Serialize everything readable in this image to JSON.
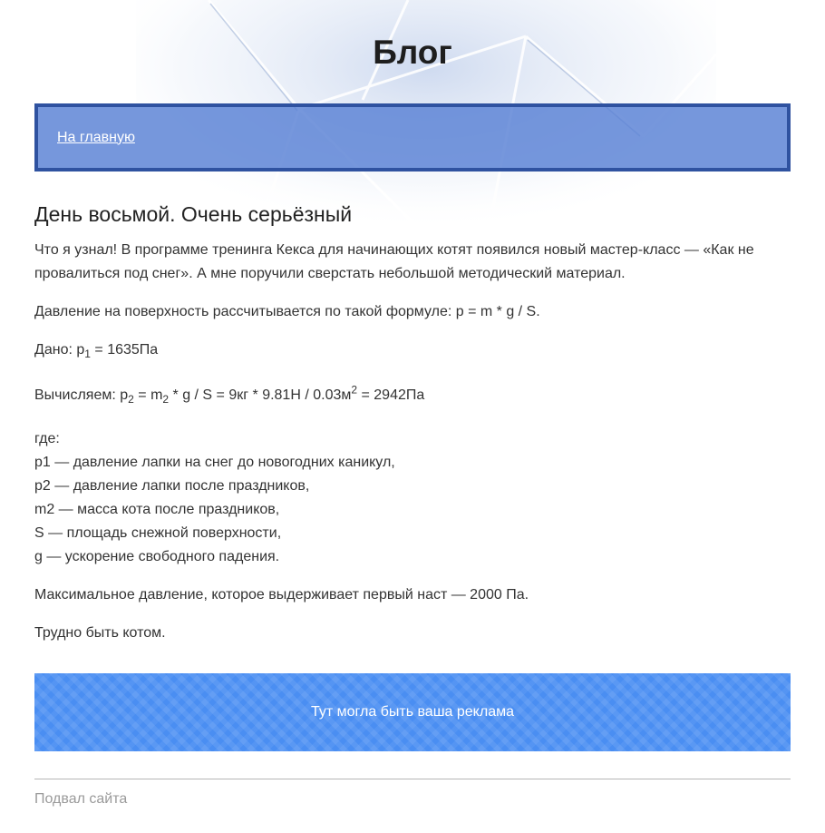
{
  "header": {
    "title": "Блог"
  },
  "nav": {
    "home_link": "На главную"
  },
  "post": {
    "title": "День восьмой. Очень серьёзный",
    "intro": "Что я узнал! В программе тренинга Кекса для начинающих котят появился новый мастер-класс — «Как не провалиться под снег». А мне поручили сверстать небольшой методический материал.",
    "formula": "Давление на поверхность рассчитывается по такой формуле: p = m * g / S.",
    "given": {
      "label": "Дано: p",
      "sub": "1",
      "rest": " = 1635Па"
    },
    "calc": {
      "prefix": "Вычисляем: p",
      "p_sub": "2",
      "mid": " = m",
      "m_sub": "2",
      "mid2": " * g / S = 9кг * 9.81Н / 0.03м",
      "sup": "2",
      "result": " = 2942Па"
    },
    "where": {
      "label": "где:",
      "items": [
        "p1 — давление лапки на снег до новогодних каникул,",
        "p2 — давление лапки после праздников,",
        "m2 — масса кота после праздников,",
        "S — площадь снежной поверхности,",
        "g — ускорение свободного падения."
      ]
    },
    "max_pressure": "Максимальное давление, которое выдерживает первый наст — 2000 Па.",
    "conclusion": "Трудно быть котом."
  },
  "ad": {
    "text": "Тут могла быть ваша реклама"
  },
  "footer": {
    "text": "Подвал сайта"
  },
  "colors": {
    "nav_border": "#2f52a0",
    "nav_bg": "#5880d4",
    "ad_bg": "#4a8ef2"
  }
}
